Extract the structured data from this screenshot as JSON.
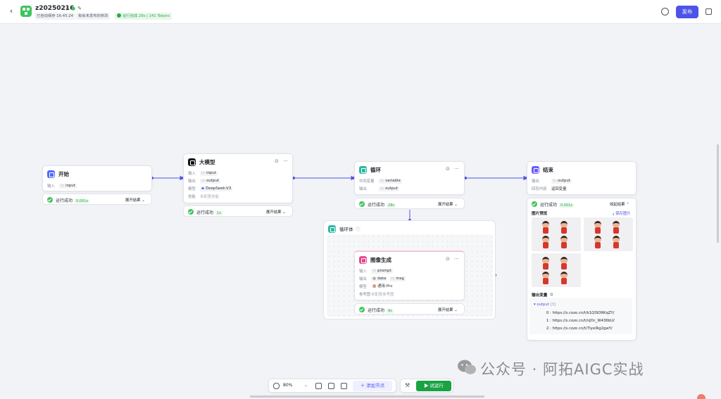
{
  "header": {
    "title": "z20250216",
    "autosave": "已自动保存 16:45:24",
    "unpublished": "有尚未发布的修改",
    "run_summary": "运行完成 29s | 141 Tokens",
    "publish_label": "发布"
  },
  "nodes": {
    "start": {
      "title": "开始",
      "input_label": "输入",
      "input_var": "input",
      "status": "运行成功",
      "time": "0.001s",
      "expand": "展开结果 ⌄"
    },
    "llm": {
      "title": "大模型",
      "input_label": "输入",
      "input_var": "input",
      "output_label": "输出",
      "output_var": "output",
      "model_label": "模型",
      "model_name": "DeepSeek-V3",
      "skill_label": "技能",
      "skill_value": "未配置技能",
      "status": "运行成功",
      "time": "1s",
      "expand": "展开结果 ⌄"
    },
    "loop": {
      "title": "循环",
      "mid_label": "中间变量",
      "mid_var": "variable",
      "output_label": "输出",
      "output_var": "output",
      "status": "运行成功",
      "time": "28s",
      "expand": "展开结果 ⌄"
    },
    "loop_body": {
      "title": "循环体"
    },
    "image_gen": {
      "title": "图像生成",
      "input_label": "输入",
      "input_var": "prompt",
      "output_label": "输出",
      "output_var1": "data",
      "output_var2": "msg",
      "model_label": "模型",
      "model_name": "通用-Pro",
      "ref_label": "参考图",
      "ref_value": "未配置参考图",
      "status": "运行成功",
      "time": "9s",
      "expand": "展开结果 ⌄"
    },
    "end": {
      "title": "结束",
      "output_label": "输出",
      "output_var": "output",
      "answer_label": "回答内容",
      "answer_value": "返回变量",
      "status": "运行成功",
      "time": "0.001s",
      "collapse": "收起结果 ⌃",
      "preview_label": "图片预览",
      "save_image": "⤓ 保存图片",
      "output_vars_label": "输出变量",
      "output_key": "▾ output",
      "output_count": "[3]",
      "urls": [
        "0 : https://s.coze.cn/t/k1QlSORKqZY/",
        "1 : https://s.coze.cn/t/nJOc_W436bU/",
        "2 : https://s.coze.cn/t/7IyeiRg2gwY/"
      ]
    }
  },
  "toolbar": {
    "zoom": "80%",
    "add_node": "＋ 添加节点",
    "test_run": "▶ 试运行"
  },
  "watermark": "公众号 · 阿拓AIGC实战",
  "colors": {
    "accent": "#4d53e8",
    "success": "#3ec45e",
    "run_button": "#19a342"
  }
}
